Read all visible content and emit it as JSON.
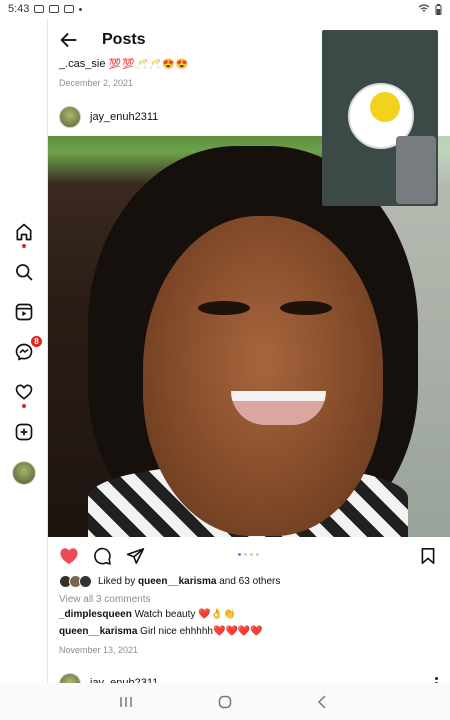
{
  "status_bar": {
    "time": "5:43"
  },
  "header": {
    "title": "Posts"
  },
  "previous_post": {
    "caption": "_.cas_sie",
    "caption_emoji": "💯💯🥂🥂😍😍",
    "date": "December 2, 2021"
  },
  "post": {
    "username": "jay_enuh2311",
    "likes_prefix": "Liked by",
    "likes_user": "queen__karisma",
    "likes_suffix": "and 63 others",
    "view_all": "View all 3 comments",
    "comments": [
      {
        "user": "_dimplesqueen",
        "text": "Watch beauty ❤️👌👏"
      },
      {
        "user": "queen__karisma",
        "text": "Girl nice ehhhhh❤️❤️❤️❤️"
      }
    ],
    "date": "November 13, 2021"
  },
  "next_post": {
    "username": "jay_enuh2311"
  },
  "sidebar": {
    "messenger_badge": "8"
  },
  "colors": {
    "like_red": "#ed4956",
    "badge_red": "#e02424",
    "link_blue": "#3897f0"
  }
}
